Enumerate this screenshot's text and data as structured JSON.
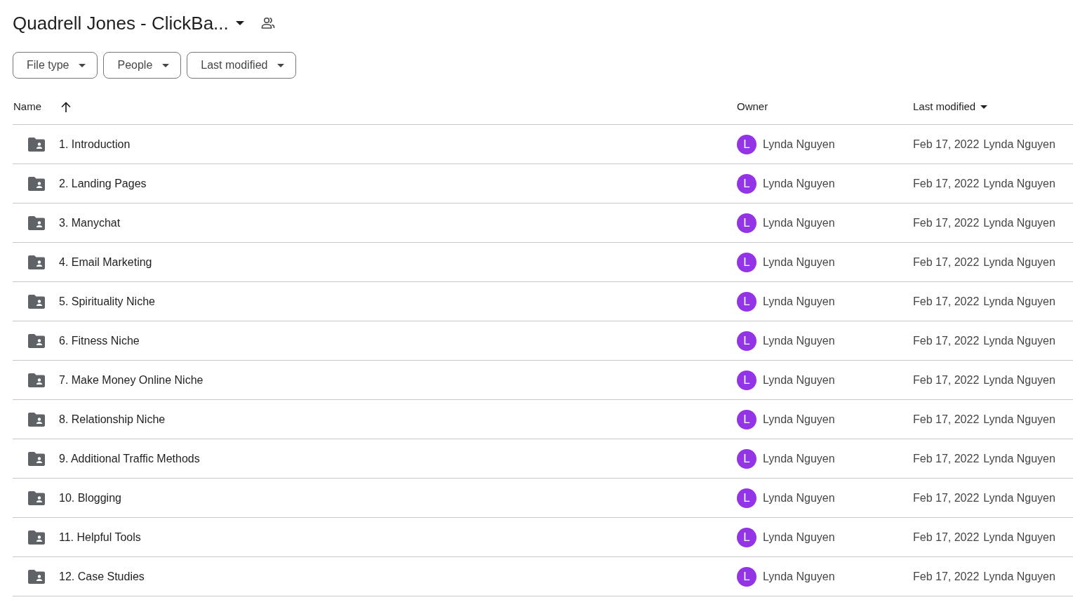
{
  "title": "Quadrell Jones - ClickBa...",
  "filters": [
    {
      "label": "File type"
    },
    {
      "label": "People"
    },
    {
      "label": "Last modified"
    }
  ],
  "columns": {
    "name": "Name",
    "owner": "Owner",
    "modified": "Last modified"
  },
  "rows": [
    {
      "name": "1. Introduction",
      "initial": "L",
      "owner": "Lynda Nguyen",
      "date": "Feb 17, 2022",
      "modified_by": "Lynda Nguyen"
    },
    {
      "name": "2. Landing Pages",
      "initial": "L",
      "owner": "Lynda Nguyen",
      "date": "Feb 17, 2022",
      "modified_by": "Lynda Nguyen"
    },
    {
      "name": "3. Manychat",
      "initial": "L",
      "owner": "Lynda Nguyen",
      "date": "Feb 17, 2022",
      "modified_by": "Lynda Nguyen"
    },
    {
      "name": "4. Email Marketing",
      "initial": "L",
      "owner": "Lynda Nguyen",
      "date": "Feb 17, 2022",
      "modified_by": "Lynda Nguyen"
    },
    {
      "name": "5. Spirituality Niche",
      "initial": "L",
      "owner": "Lynda Nguyen",
      "date": "Feb 17, 2022",
      "modified_by": "Lynda Nguyen"
    },
    {
      "name": "6. Fitness Niche",
      "initial": "L",
      "owner": "Lynda Nguyen",
      "date": "Feb 17, 2022",
      "modified_by": "Lynda Nguyen"
    },
    {
      "name": "7. Make Money Online Niche",
      "initial": "L",
      "owner": "Lynda Nguyen",
      "date": "Feb 17, 2022",
      "modified_by": "Lynda Nguyen"
    },
    {
      "name": "8. Relationship Niche",
      "initial": "L",
      "owner": "Lynda Nguyen",
      "date": "Feb 17, 2022",
      "modified_by": "Lynda Nguyen"
    },
    {
      "name": "9. Additional Traffic Methods",
      "initial": "L",
      "owner": "Lynda Nguyen",
      "date": "Feb 17, 2022",
      "modified_by": "Lynda Nguyen"
    },
    {
      "name": "10. Blogging",
      "initial": "L",
      "owner": "Lynda Nguyen",
      "date": "Feb 17, 2022",
      "modified_by": "Lynda Nguyen"
    },
    {
      "name": "11. Helpful Tools",
      "initial": "L",
      "owner": "Lynda Nguyen",
      "date": "Feb 17, 2022",
      "modified_by": "Lynda Nguyen"
    },
    {
      "name": "12. Case Studies",
      "initial": "L",
      "owner": "Lynda Nguyen",
      "date": "Feb 17, 2022",
      "modified_by": "Lynda Nguyen"
    }
  ]
}
